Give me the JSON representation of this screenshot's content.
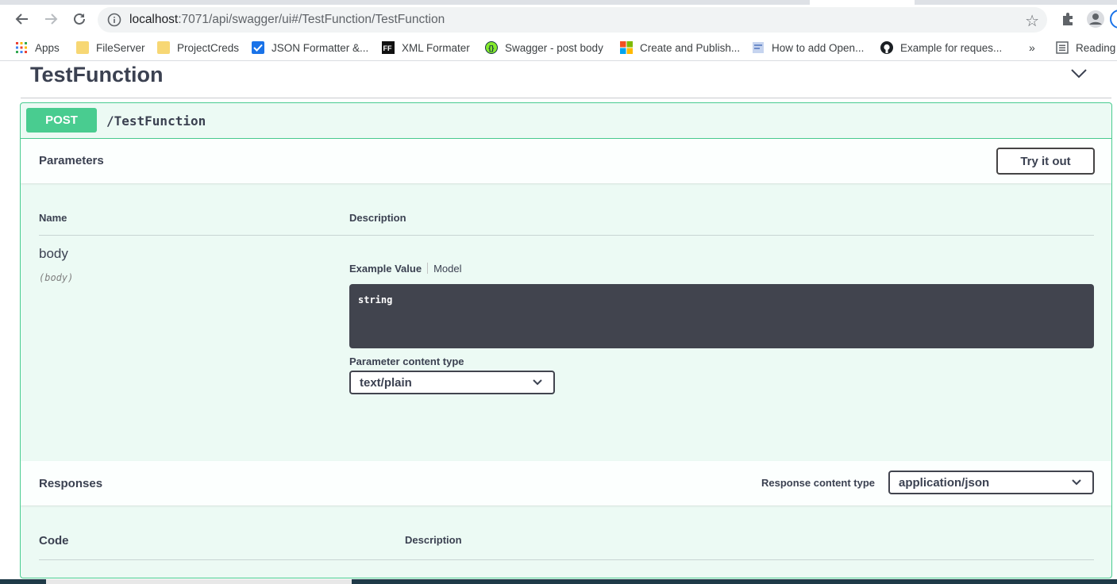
{
  "browser": {
    "url_host": "localhost",
    "url_rest": ":7071/api/swagger/ui#/TestFunction/TestFunction",
    "bookmarks": [
      "Apps",
      "FileServer",
      "ProjectCreds",
      "JSON Formatter &...",
      "XML Formater",
      "Swagger - post body",
      "Create and Publish...",
      "How to add Open...",
      "Example for reques...",
      "Reading"
    ],
    "more_label": "»"
  },
  "tag": {
    "title": "TestFunction"
  },
  "operation": {
    "method": "POST",
    "path": "/TestFunction",
    "method_color": "#49cc90"
  },
  "parameters": {
    "title": "Parameters",
    "try_label": "Try it out",
    "col_name": "Name",
    "col_description": "Description",
    "param": {
      "name": "body",
      "in": "(body)"
    },
    "example_tab": "Example Value",
    "model_tab": "Model",
    "example_code": "string",
    "content_type_label": "Parameter content type",
    "content_type_value": "text/plain"
  },
  "responses": {
    "title": "Responses",
    "content_type_label": "Response content type",
    "content_type_value": "application/json",
    "col_code": "Code",
    "col_description": "Description"
  }
}
